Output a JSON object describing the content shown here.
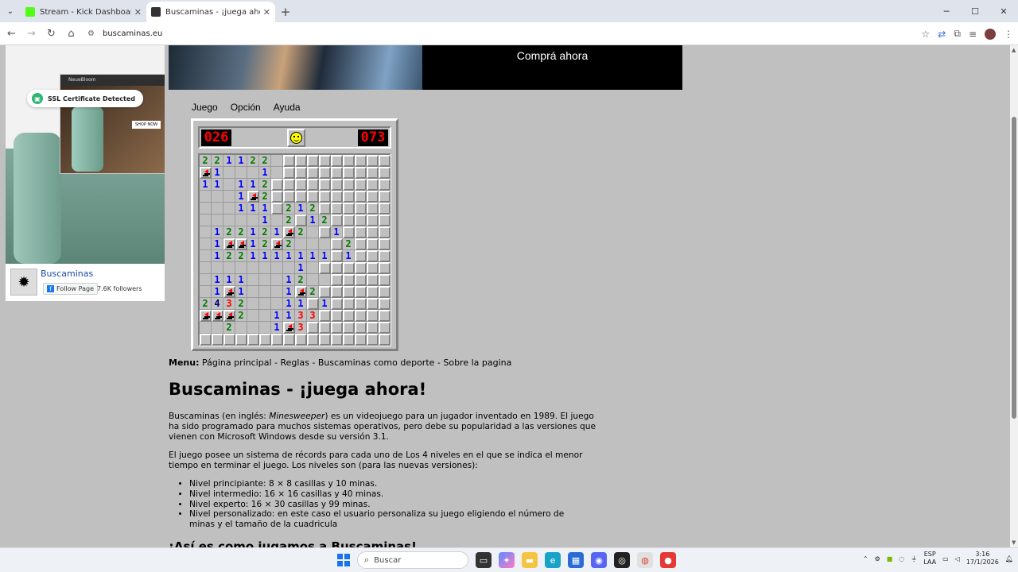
{
  "browser": {
    "tabs": [
      {
        "title": "Stream - Kick Dashboard",
        "favicon_color": "#53fc18",
        "active": false
      },
      {
        "title": "Buscaminas - ¡juega ahora!",
        "favicon_color": "#333333",
        "active": true
      }
    ],
    "url": "buscaminas.eu",
    "window_controls": [
      "─",
      "☐",
      "✕"
    ]
  },
  "ads": {
    "banner_cta": "Comprá ahora",
    "ssl_badge": "SSL Certificate Detected",
    "promo_brand": "NeueBloom",
    "promo_shop": "SHOP NOW"
  },
  "facebook": {
    "page_name": "Buscaminas",
    "follow_label": "Follow Page",
    "followers": "7.6K followers"
  },
  "game": {
    "menu": [
      "Juego",
      "Opción",
      "Ayuda"
    ],
    "mines_left": "026",
    "timer": "073",
    "face": "smile",
    "rows": [
      "2211220.........",
      "F100010.........",
      "110112..........",
      "0001F2..........",
      "000111.212......",
      "00000102.12.....",
      "0122121F20.1....",
      "01FF12F2000.2...",
      "01221111111.1...",
      "0000000010......",
      "01110001200.....",
      "01F10001F2......",
      "243200011.1.....",
      "FFF2001133......",
      "0020001F3......."
    ],
    "legend": {
      "0": "opened-empty",
      ".": "hidden",
      "F": "flag"
    }
  },
  "article": {
    "menu_label": "Menu:",
    "menu_links": "Página principal - Reglas - Buscaminas como deporte - Sobre la pagina",
    "title": "Buscaminas - ¡juega ahora!",
    "p1_a": "Buscaminas (en inglés: ",
    "p1_em": "Minesweeper",
    "p1_b": ") es un videojuego para un jugador inventado en 1989. El juego ha sido programado para muchos sistemas operativos, pero debe su popularidad a las versiones que vienen con Microsoft Windows desde su versión 3.1.",
    "p2": "El juego posee un sistema de récords para cada uno de Los 4 niveles en el que se indica el menor tiempo en terminar el juego. Los niveles son (para las nuevas versiones):",
    "levels": [
      "Nivel principiante: 8 × 8 casillas y 10 minas.",
      "Nivel intermedio: 16 × 16 casillas y 40 minas.",
      "Nivel experto: 16 × 30 casillas y 99 minas.",
      "Nivel personalizado: en este caso el usuario personaliza su juego eligiendo el número de minas y el tamaño de la cuadricula"
    ],
    "next_heading": "¡Así es como jugamos a Buscaminas!"
  },
  "taskbar": {
    "search_placeholder": "Buscar",
    "lang_top": "ESP",
    "lang_bottom": "LAA",
    "time": "3:16",
    "date": "17/1/2026"
  }
}
